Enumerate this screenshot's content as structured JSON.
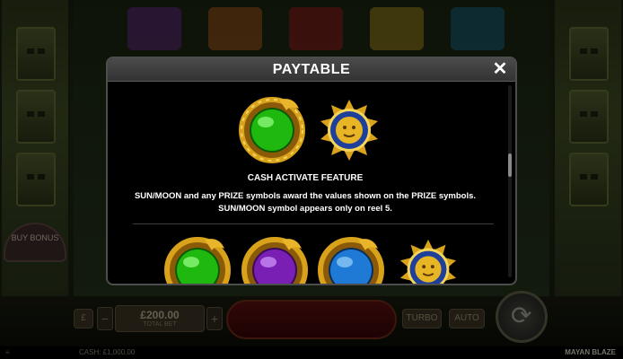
{
  "game": {
    "name": "MAYAN BLAZE"
  },
  "background": {
    "bonus_badge": "BUY BONUS",
    "bet_value": "£200.00",
    "bet_label": "TOTAL BET",
    "bet_minus": "−",
    "bet_plus": "+",
    "left_button": "£",
    "turbo_label": "TURBO",
    "auto_label": "AUTO",
    "cash_text": "CASH: £1,000.00"
  },
  "paytable": {
    "title": "PAYTABLE",
    "close_glyph": "✕",
    "feature_title": "CASH ACTIVATE FEATURE",
    "desc_line1": "SUN/MOON and any PRIZE symbols award the values shown on the PRIZE symbols.",
    "desc_line2": "SUN/MOON symbol appears only on reel 5.",
    "top_symbols": [
      "green-orb-dragon",
      "sun-moon"
    ],
    "bottom_symbols": [
      "green-orb-dragon",
      "purple-orb-dragon",
      "blue-orb-dragon",
      "sun-moon"
    ]
  },
  "colors": {
    "green_orb": "#1fb80f",
    "purple_orb": "#7a1fb3",
    "blue_orb": "#1f7ad6",
    "gold": "#d9a21b",
    "sun_bg": "#1e3f9a"
  }
}
